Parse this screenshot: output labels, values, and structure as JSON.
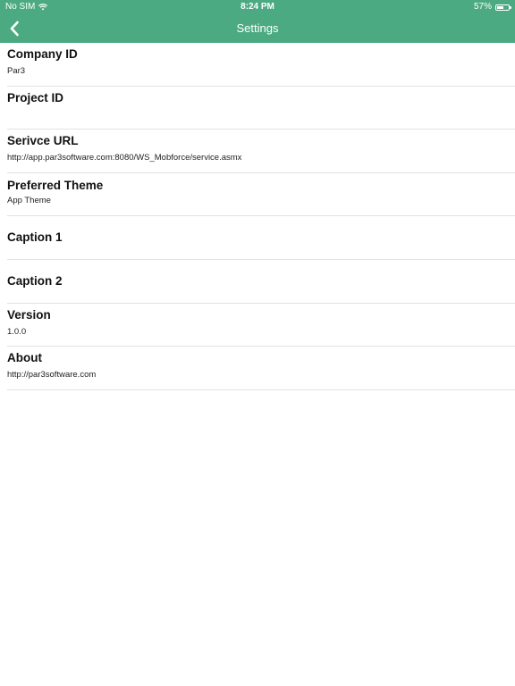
{
  "status_bar": {
    "carrier": "No SIM",
    "time": "8:24 PM",
    "battery_text": "57%",
    "battery_level": 0.57
  },
  "nav": {
    "title": "Settings",
    "back_icon": "chevron-left-icon"
  },
  "settings": [
    {
      "label": "Company ID",
      "value": "Par3"
    },
    {
      "label": "Project ID",
      "value": ""
    },
    {
      "label": "Serivce URL",
      "value": "http://app.par3software.com:8080/WS_Mobforce/service.asmx"
    },
    {
      "label": "Preferred Theme",
      "value": "App Theme"
    },
    {
      "label": "Caption 1",
      "value": ""
    },
    {
      "label": "Caption 2",
      "value": ""
    },
    {
      "label": "Version",
      "value": "1.0.0"
    },
    {
      "label": "About",
      "value": "http://par3software.com"
    }
  ],
  "colors": {
    "header": "#4caa82",
    "divider": "#e2e2e2"
  }
}
